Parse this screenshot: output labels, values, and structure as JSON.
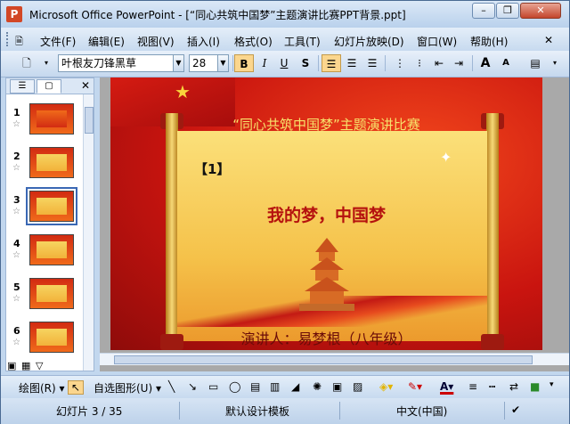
{
  "window": {
    "title": "Microsoft Office PowerPoint - [“同心共筑中国梦”主题演讲比赛PPT背景.ppt]",
    "minimize": "–",
    "restore": "❐",
    "close": "✕"
  },
  "menu": [
    "文件(F)",
    "编辑(E)",
    "视图(V)",
    "插入(I)",
    "格式(O)",
    "工具(T)",
    "幻灯片放映(D)",
    "窗口(W)",
    "帮助(H)"
  ],
  "toolbar": {
    "font_name": "叶根友刀锋黑草",
    "font_size": "28",
    "bold": "B",
    "italic": "I",
    "underline": "U",
    "shadow": "S",
    "grow_font": "A",
    "shrink_font": "A"
  },
  "slides_pane": {
    "tabs": [
      "outline-icon",
      "slides-icon"
    ],
    "close": "✕",
    "slides": [
      {
        "num": "1"
      },
      {
        "num": "2"
      },
      {
        "num": "3",
        "selected": true
      },
      {
        "num": "4"
      },
      {
        "num": "5"
      },
      {
        "num": "6"
      }
    ]
  },
  "slide": {
    "title": "“同心共筑中国梦”主题演讲比赛",
    "number": "【1】",
    "main_text": "我的梦，中国梦",
    "speaker": "演讲人：易梦根（八年级）"
  },
  "drawing_toolbar": {
    "draw": "绘图(R) ▾",
    "autoshapes": "自选图形(U) ▾"
  },
  "status": {
    "slide_info": "幻灯片 3 / 35",
    "design": "默认设计模板",
    "language": "中文(中国)"
  }
}
